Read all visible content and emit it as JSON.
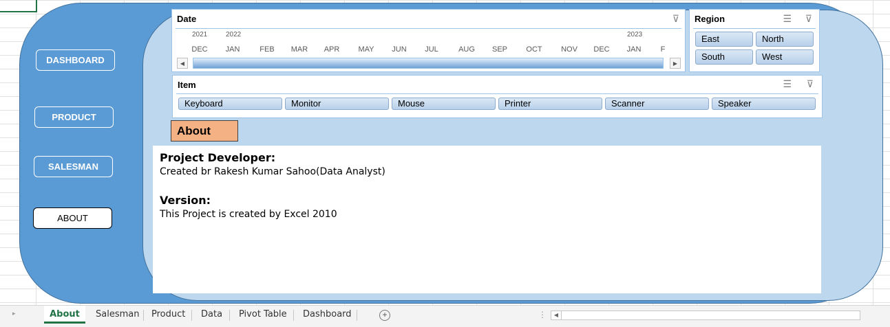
{
  "nav": {
    "dashboard": "DASHBOARD",
    "product": "PRODUCT",
    "salesman": "SALESMAN",
    "about": "ABOUT"
  },
  "date_slicer": {
    "title": "Date",
    "years": [
      "2021",
      "2022",
      "2023"
    ],
    "months": [
      "DEC",
      "JAN",
      "FEB",
      "MAR",
      "APR",
      "MAY",
      "JUN",
      "JUL",
      "AUG",
      "SEP",
      "OCT",
      "NOV",
      "DEC",
      "JAN",
      "F"
    ]
  },
  "region_slicer": {
    "title": "Region",
    "items": [
      "East",
      "North",
      "South",
      "West"
    ]
  },
  "item_slicer": {
    "title": "Item",
    "items": [
      "Keyboard",
      "Monitor",
      "Mouse",
      "Printer",
      "Scanner",
      "Speaker"
    ]
  },
  "about_label": "About",
  "content": {
    "developer_heading": "Project Developer:",
    "developer_text": "Created br Rakesh Kumar Sahoo(Data Analyst)",
    "version_heading": "Version:",
    "version_text": "This Project is created by Excel 2010"
  },
  "sheet_tabs": [
    "About",
    "Salesman",
    "Product",
    "Data",
    "Pivot Table",
    "Dashboard"
  ],
  "active_tab": "About",
  "colors": {
    "outer_panel": "#5b9bd5",
    "inner_panel": "#bdd7ee",
    "about_label_bg": "#f4b183",
    "excel_green": "#217346"
  }
}
